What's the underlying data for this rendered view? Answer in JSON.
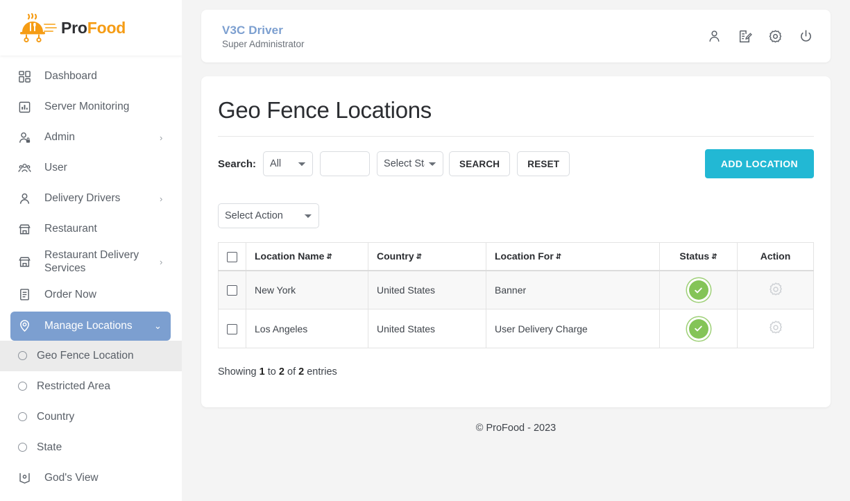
{
  "brand": {
    "pro": "Pro",
    "food": "Food",
    "accent_orange": "#f59c15"
  },
  "sidebar": {
    "items": [
      {
        "label": "Dashboard",
        "icon": "dashboard-grid-icon",
        "caret": ""
      },
      {
        "label": "Server Monitoring",
        "icon": "bar-chart-icon",
        "caret": ""
      },
      {
        "label": "Admin",
        "icon": "user-lock-icon",
        "caret": "›"
      },
      {
        "label": "User",
        "icon": "users-group-icon",
        "caret": ""
      },
      {
        "label": "Delivery Drivers",
        "icon": "person-icon",
        "caret": "›"
      },
      {
        "label": "Restaurant",
        "icon": "store-icon",
        "caret": ""
      },
      {
        "label": "Restaurant Delivery Services",
        "icon": "store-icon",
        "caret": "›"
      },
      {
        "label": "Order Now",
        "icon": "order-list-icon",
        "caret": ""
      }
    ],
    "active_item": {
      "label": "Manage Locations",
      "icon": "location-pin-icon",
      "caret": "⌄"
    },
    "sub_items": [
      {
        "label": "Geo Fence Location",
        "selected": true
      },
      {
        "label": "Restricted Area",
        "selected": false
      },
      {
        "label": "Country",
        "selected": false
      },
      {
        "label": "State",
        "selected": false
      }
    ],
    "after_items": [
      {
        "label": "God's View",
        "icon": "map-pin-view-icon",
        "caret": ""
      }
    ],
    "active_color": "#7c9fd0"
  },
  "topbar": {
    "user_name": "V3C Driver",
    "user_role": "Super Administrator",
    "actions": [
      {
        "name": "profile-icon"
      },
      {
        "name": "edit-document-icon"
      },
      {
        "name": "settings-gear-icon"
      },
      {
        "name": "power-logout-icon"
      }
    ]
  },
  "page": {
    "title": "Geo Fence Locations",
    "search_label": "Search:",
    "search_scope_value": "All",
    "search_scope_options": [
      "All"
    ],
    "search_text_value": "",
    "search_text_placeholder": "",
    "status_filter_value": "Select Status",
    "status_filter_options": [
      "Select Status"
    ],
    "search_button": "SEARCH",
    "reset_button": "RESET",
    "add_button": "ADD LOCATION",
    "add_button_color": "#22b8d4",
    "action_select_value": "Select Action",
    "action_select_options": [
      "Select Action"
    ]
  },
  "table": {
    "columns": [
      {
        "label": "",
        "sortable": false,
        "type": "checkbox"
      },
      {
        "label": "Location Name",
        "sortable": true
      },
      {
        "label": "Country",
        "sortable": true
      },
      {
        "label": "Location For",
        "sortable": true
      },
      {
        "label": "Status",
        "sortable": true,
        "align": "center"
      },
      {
        "label": "Action",
        "sortable": false,
        "align": "center"
      }
    ],
    "sort_glyph": "⇵",
    "rows": [
      {
        "name": "New York",
        "country": "United States",
        "location_for": "Banner",
        "status": "active",
        "action": "settings-gear-icon"
      },
      {
        "name": "Los Angeles",
        "country": "United States",
        "location_for": "User Delivery Charge",
        "status": "active",
        "action": "settings-gear-icon"
      }
    ],
    "status_color": "#84c457"
  },
  "showing": {
    "prefix": "Showing",
    "from": "1",
    "mid": "to",
    "to": "2",
    "of": "of",
    "total": "2",
    "suffix": "entries"
  },
  "footer": {
    "text": "© ProFood - 2023"
  }
}
